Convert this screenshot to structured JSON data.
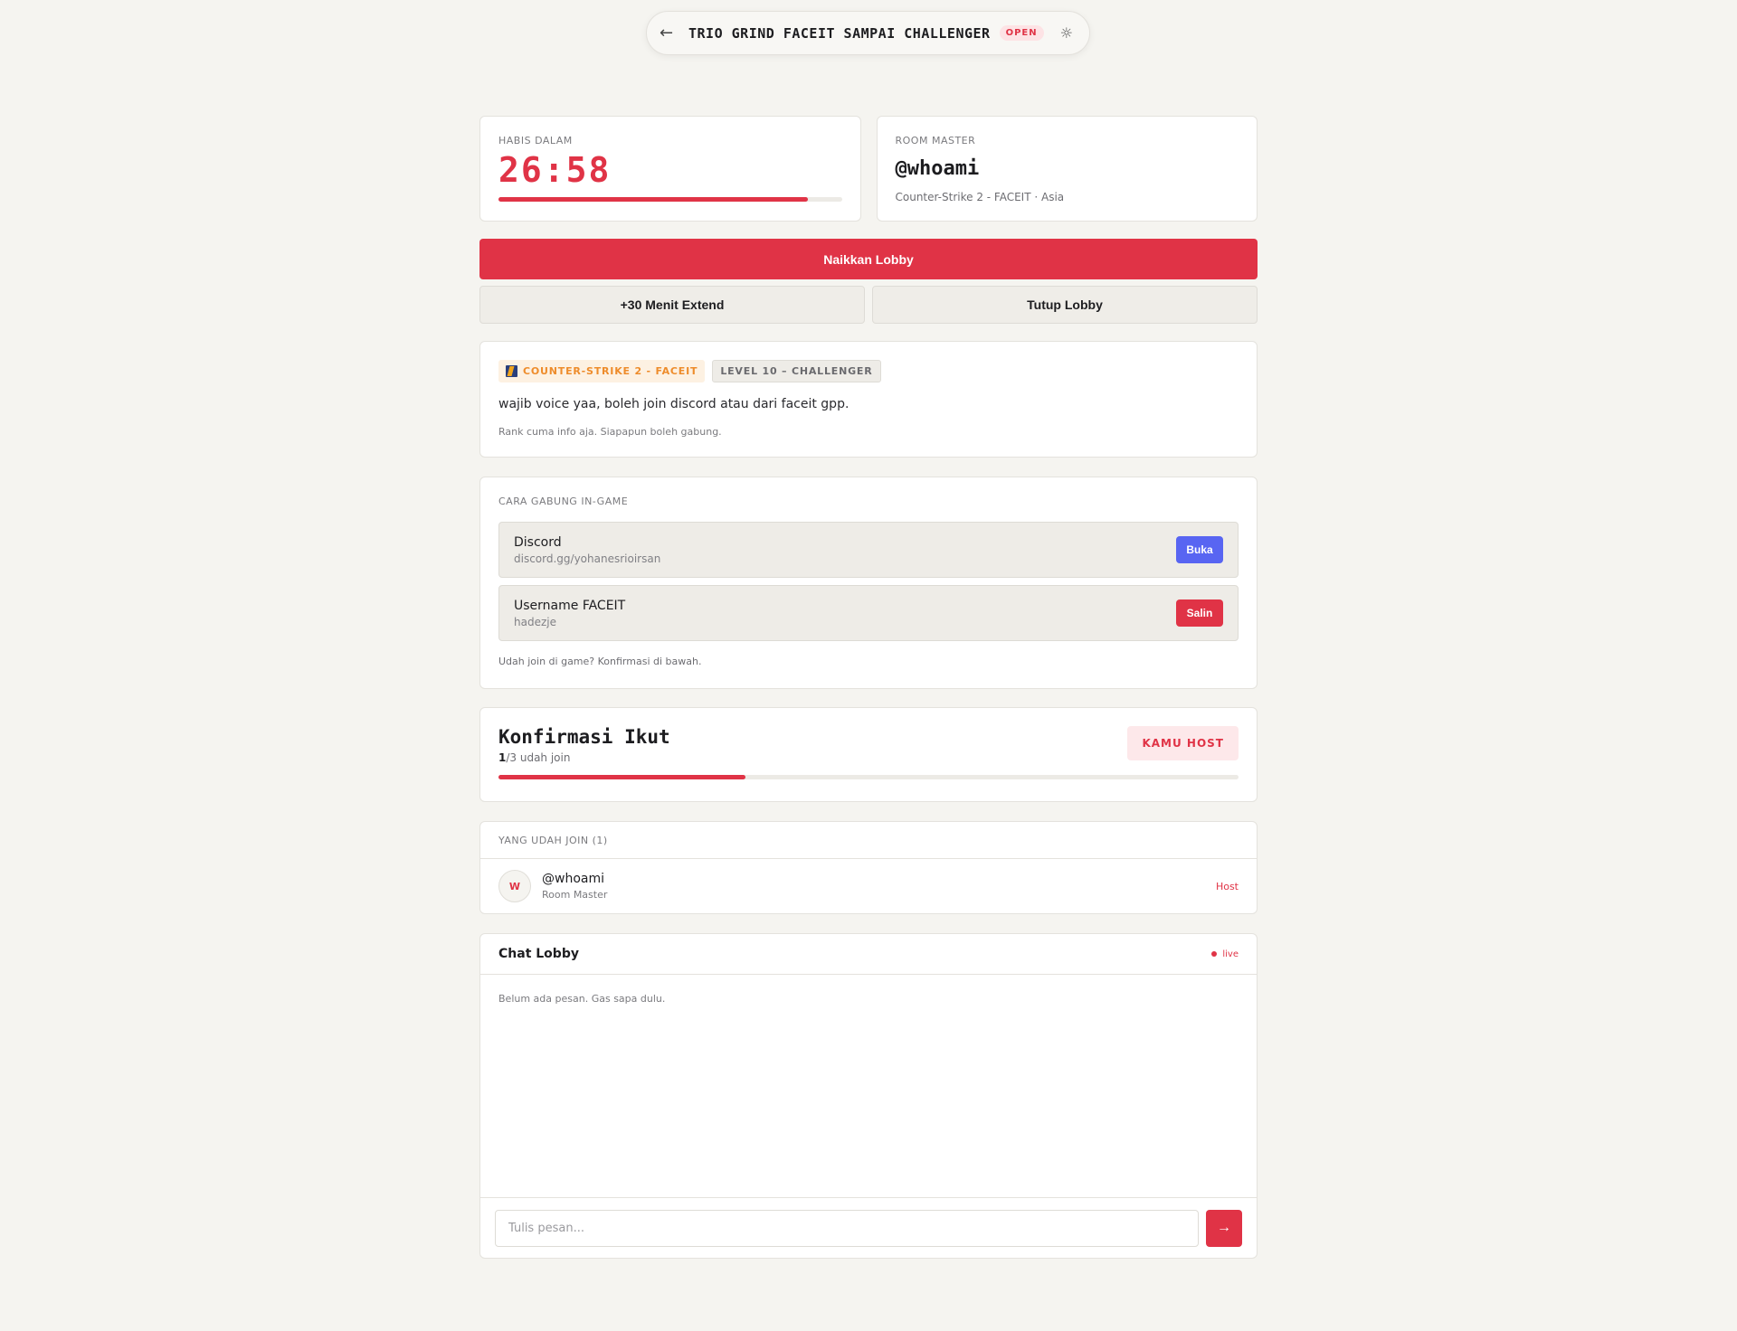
{
  "header": {
    "back_icon": "←",
    "title": "TRIO GRIND FACEIT SAMPAI CHALLENGER",
    "status": "OPEN",
    "theme_icon": "☼"
  },
  "timer_card": {
    "label": "HABIS DALAM",
    "value": "26:58",
    "progress": 0.9
  },
  "room_master_card": {
    "label": "ROOM MASTER",
    "name": "@whoami",
    "meta": "Counter-Strike 2 - FACEIT · Asia"
  },
  "actions": {
    "primary": "Naikkan Lobby",
    "extend": "+30 Menit Extend",
    "close": "Tutup Lobby"
  },
  "info": {
    "game_tag": "COUNTER-STRIKE 2 - FACEIT",
    "level_tag": "LEVEL 10 – CHALLENGER",
    "description": "wajib voice yaa, boleh join discord atau dari faceit gpp.",
    "note": "Rank cuma info aja. Siapapun boleh gabung."
  },
  "join": {
    "label": "CARA GABUNG IN-GAME",
    "methods": [
      {
        "title": "Discord",
        "value": "discord.gg/yohanesrioirsan",
        "button": "Buka",
        "color": "#5865f2"
      },
      {
        "title": "Username FACEIT",
        "value": "hadezje",
        "button": "Salin",
        "color": "#e03346"
      }
    ],
    "note": "Udah join di game? Konfirmasi di bawah."
  },
  "confirm": {
    "title": "Konfirmasi Ikut",
    "joined": "1",
    "total_text": "/3 udah join",
    "badge": "KAMU HOST",
    "progress": 0.3333
  },
  "joined_list": {
    "label": "YANG UDAH JOIN (1)",
    "members": [
      {
        "initial": "W",
        "name": "@whoami",
        "role": "Room Master",
        "tag": "Host"
      }
    ]
  },
  "chat": {
    "title": "Chat Lobby",
    "live": "live",
    "empty": "Belum ada pesan. Gas sapa dulu.",
    "placeholder": "Tulis pesan...",
    "send_icon": "→"
  }
}
